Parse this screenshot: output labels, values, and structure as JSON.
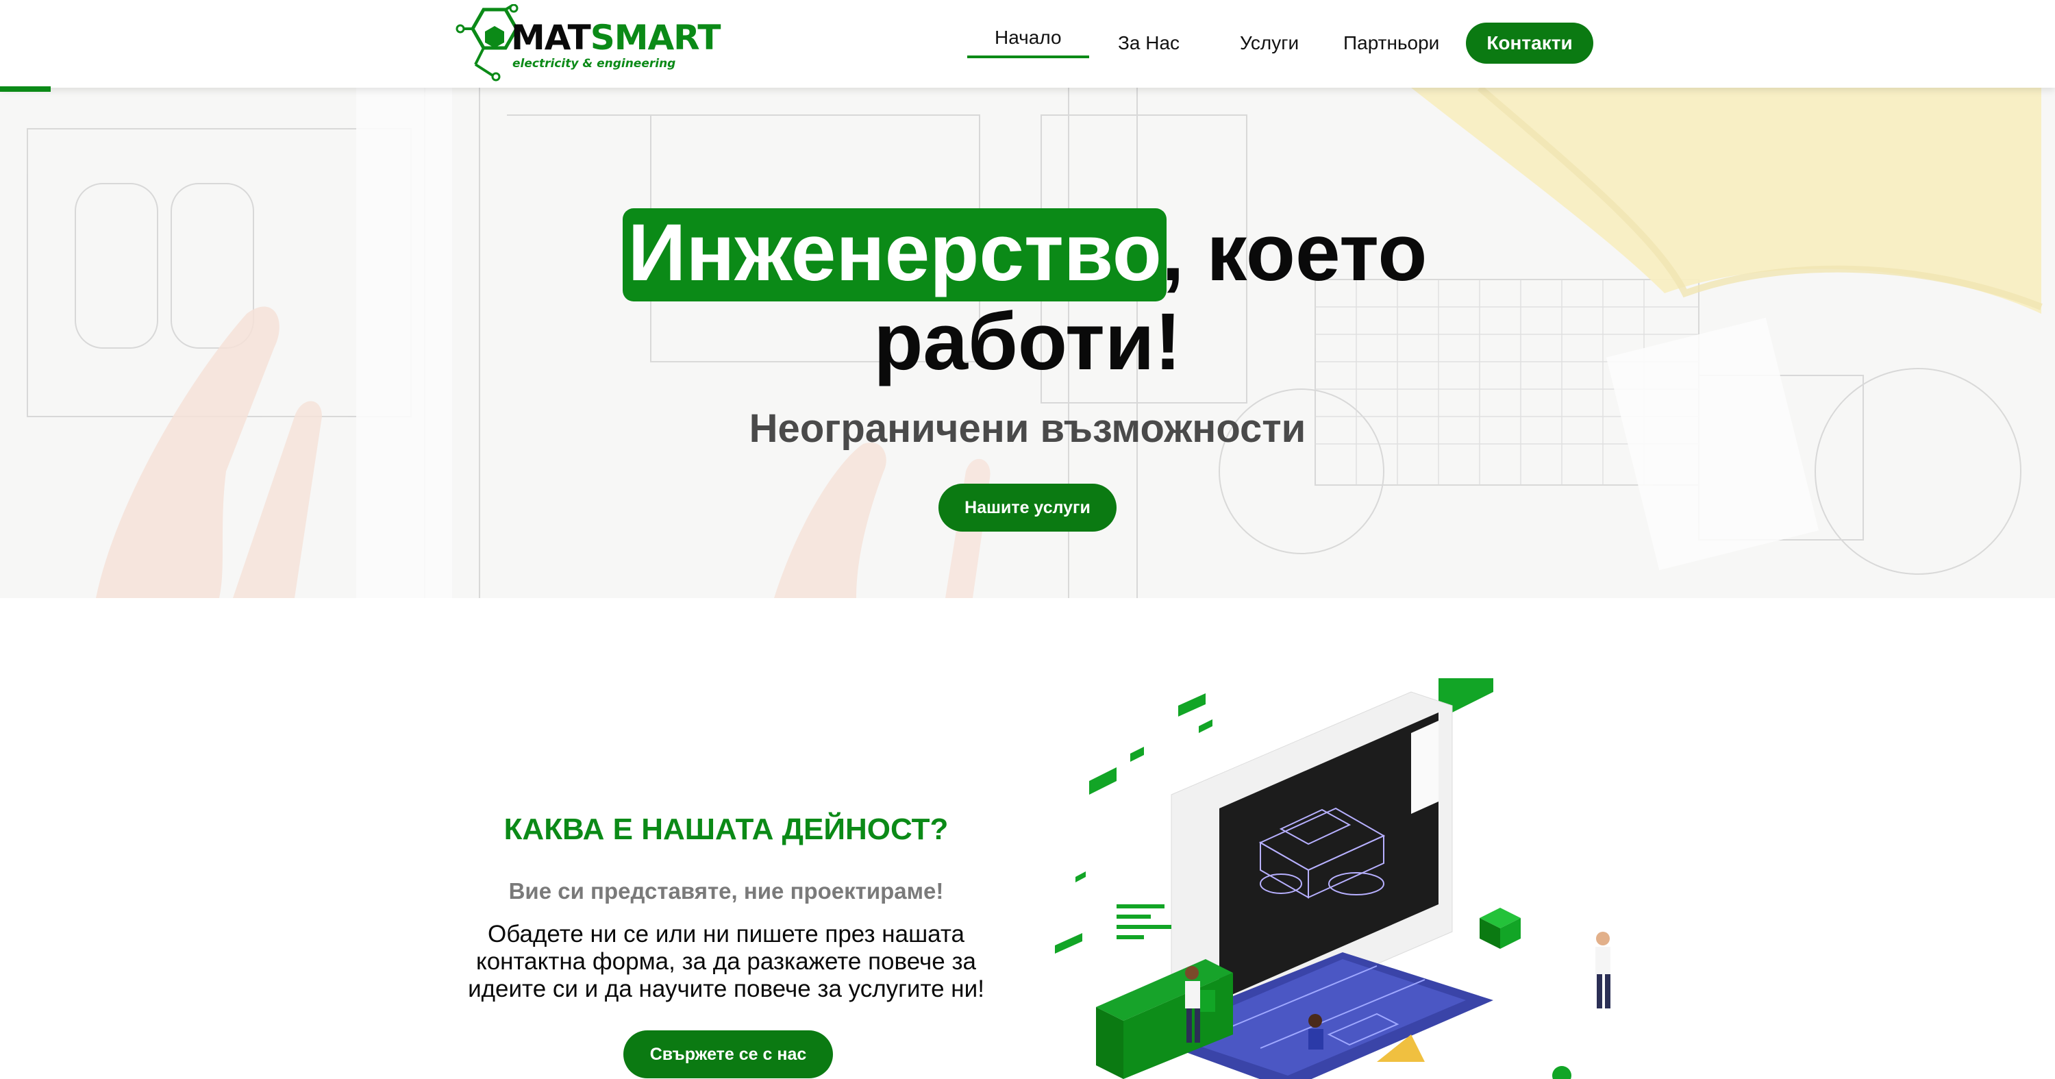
{
  "brand": {
    "name_part1": "MAT",
    "name_part2": "SMART",
    "tagline": "electricity & engineering",
    "colors": {
      "primary": "#0b8a17",
      "button": "#0b7a12"
    }
  },
  "nav": {
    "items": [
      {
        "label": "Начало",
        "active": true
      },
      {
        "label": "За Нас",
        "active": false
      },
      {
        "label": "Услуги",
        "active": false
      },
      {
        "label": "Партньори",
        "active": false
      }
    ],
    "contact_label": "Контакти"
  },
  "hero": {
    "title_highlight": "Инженерство",
    "title_rest_line1": ", което",
    "title_line2": "работи!",
    "subtitle": "Неограничени възможности",
    "button_label": "Нашите услуги"
  },
  "about": {
    "heading": "КАКВА Е НАШАТА ДЕЙНОСТ?",
    "subheading": "Вие си представяте, ние проектираме!",
    "body": "Обадете ни се или ни пишете през нашата контактна форма, за да разкажете повече за идеите си и да научите повече за услугите ни!",
    "button_label": "Свържете се с нас"
  }
}
